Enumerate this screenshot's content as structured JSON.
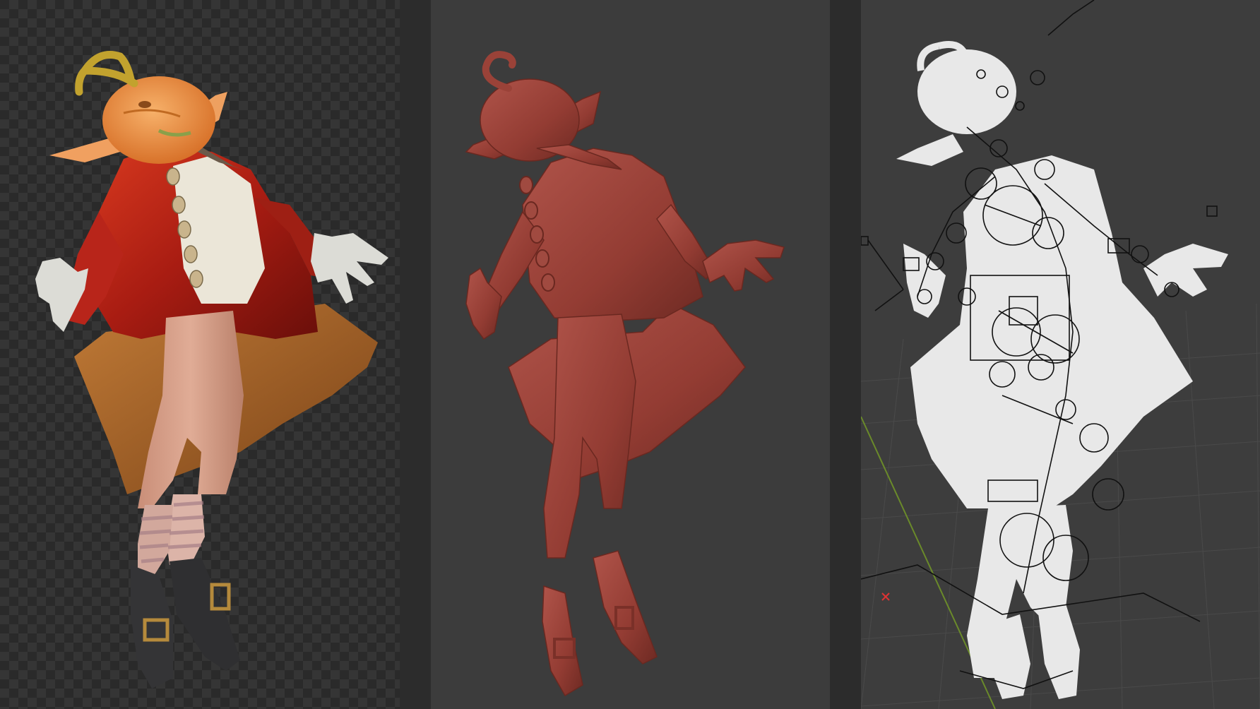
{
  "panels": [
    {
      "id": "render",
      "shading": "textured",
      "background": "checkerboard"
    },
    {
      "id": "clay",
      "shading": "clay",
      "background": "solid-gray"
    },
    {
      "id": "rig",
      "shading": "wireframe-rig",
      "background": "viewport-grid"
    }
  ],
  "colors": {
    "checker_dark": "#2a2a2a",
    "checker_light": "#353535",
    "clay": "#9a4238",
    "clay_shadow": "#6e2c25",
    "coat_red": "#b02417",
    "coat_lining": "#a8692a",
    "pumpkin": "#e98a3a",
    "stem": "#b89a2c",
    "skin": "#d9a08a",
    "shirt": "#e9e4d6",
    "gloves": "#d8d8d2",
    "socks": "#d9b3a8",
    "shoes": "#2e2e30",
    "buckle": "#b58a3c",
    "silhouette": "#e6e6e6",
    "rig_lines": "#111111",
    "grid_line": "#4a4a4a",
    "axis_green": "#6a8a2a"
  }
}
